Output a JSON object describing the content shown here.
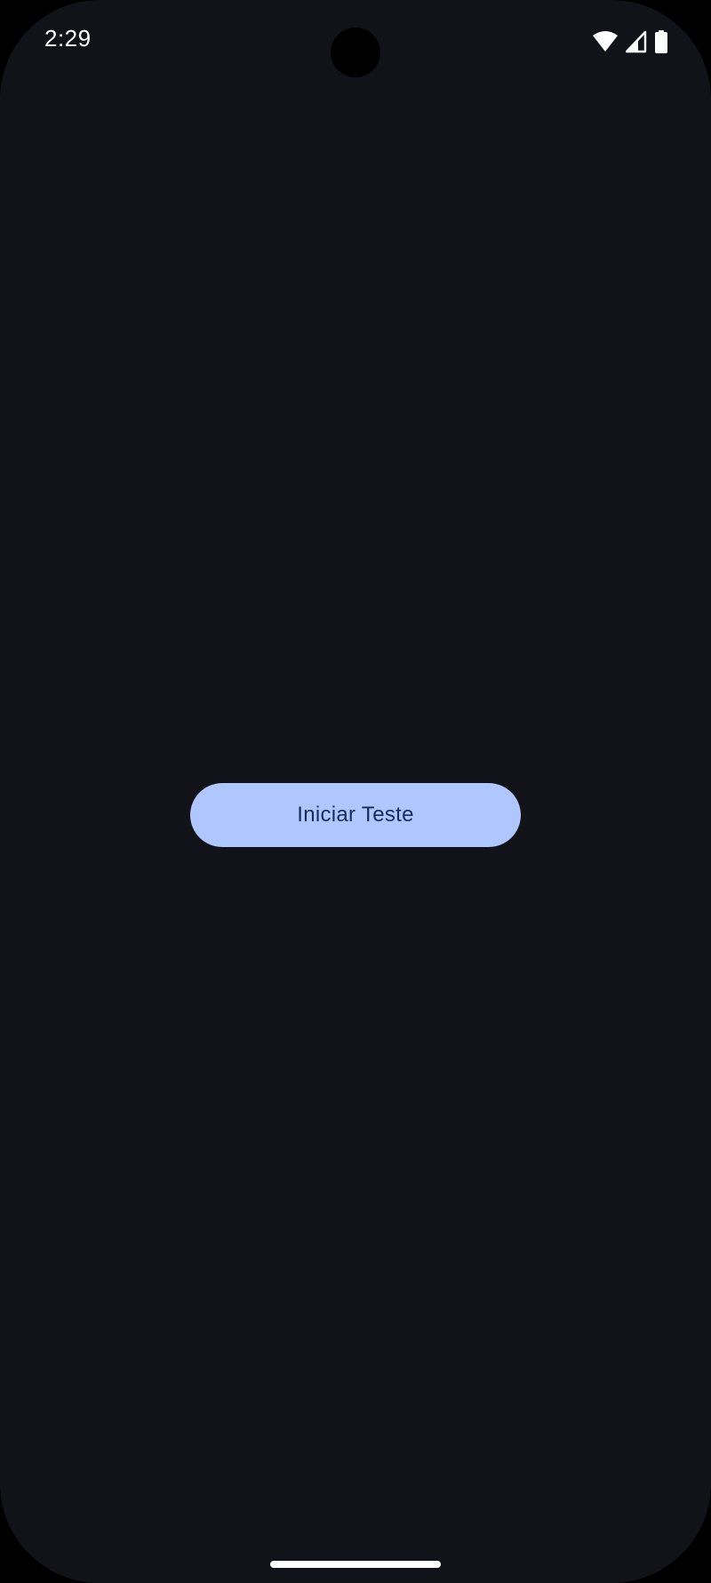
{
  "status_bar": {
    "time": "2:29",
    "icons": [
      "wifi-icon",
      "cell-signal-icon",
      "battery-icon"
    ]
  },
  "main": {
    "start_button_label": "Iniciar Teste"
  },
  "colors": {
    "background": "#121318",
    "button_fill": "#b0c6ff",
    "button_text": "#182c5c",
    "status_text": "#ffffff"
  }
}
